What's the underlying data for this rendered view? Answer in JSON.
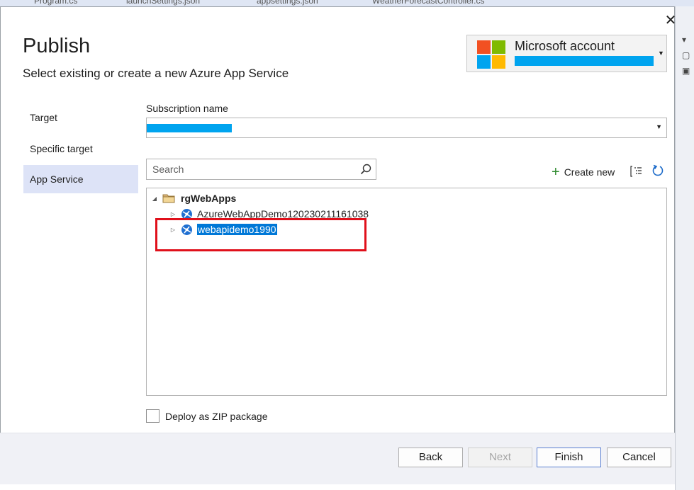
{
  "background_tabs": [
    "Program.cs",
    "launchSettings.json",
    "appsettings.json",
    "WeatherForecastController.cs"
  ],
  "dialog": {
    "title": "Publish",
    "subtitle": "Select existing or create a new Azure App Service",
    "close_label": "✕"
  },
  "account": {
    "name": "Microsoft account",
    "email_redacted": true
  },
  "nav": {
    "items": [
      {
        "label": "Target",
        "active": false
      },
      {
        "label": "Specific target",
        "active": false
      },
      {
        "label": "App Service",
        "active": true
      }
    ]
  },
  "subscription": {
    "label": "Subscription name",
    "value_redacted": true
  },
  "search": {
    "placeholder": "Search",
    "value": ""
  },
  "toolbar": {
    "create_new_label": "Create new",
    "icons": [
      "plus-icon",
      "view-options-icon",
      "refresh-icon"
    ]
  },
  "tree": {
    "group": {
      "label": "rgWebApps",
      "expanded": true,
      "children": [
        {
          "label": "AzureWebAppDemo120230211161038",
          "selected": false
        },
        {
          "label": "webapidemo1990",
          "selected": true
        }
      ]
    }
  },
  "deploy_zip": {
    "label": "Deploy as ZIP package",
    "checked": false
  },
  "buttons": {
    "back": "Back",
    "next": "Next",
    "finish": "Finish",
    "cancel": "Cancel"
  },
  "colors": {
    "accent": "#0078d7",
    "highlight_box": "#e0101b",
    "nav_active": "#dde3f7",
    "redaction": "#00a4ef"
  }
}
